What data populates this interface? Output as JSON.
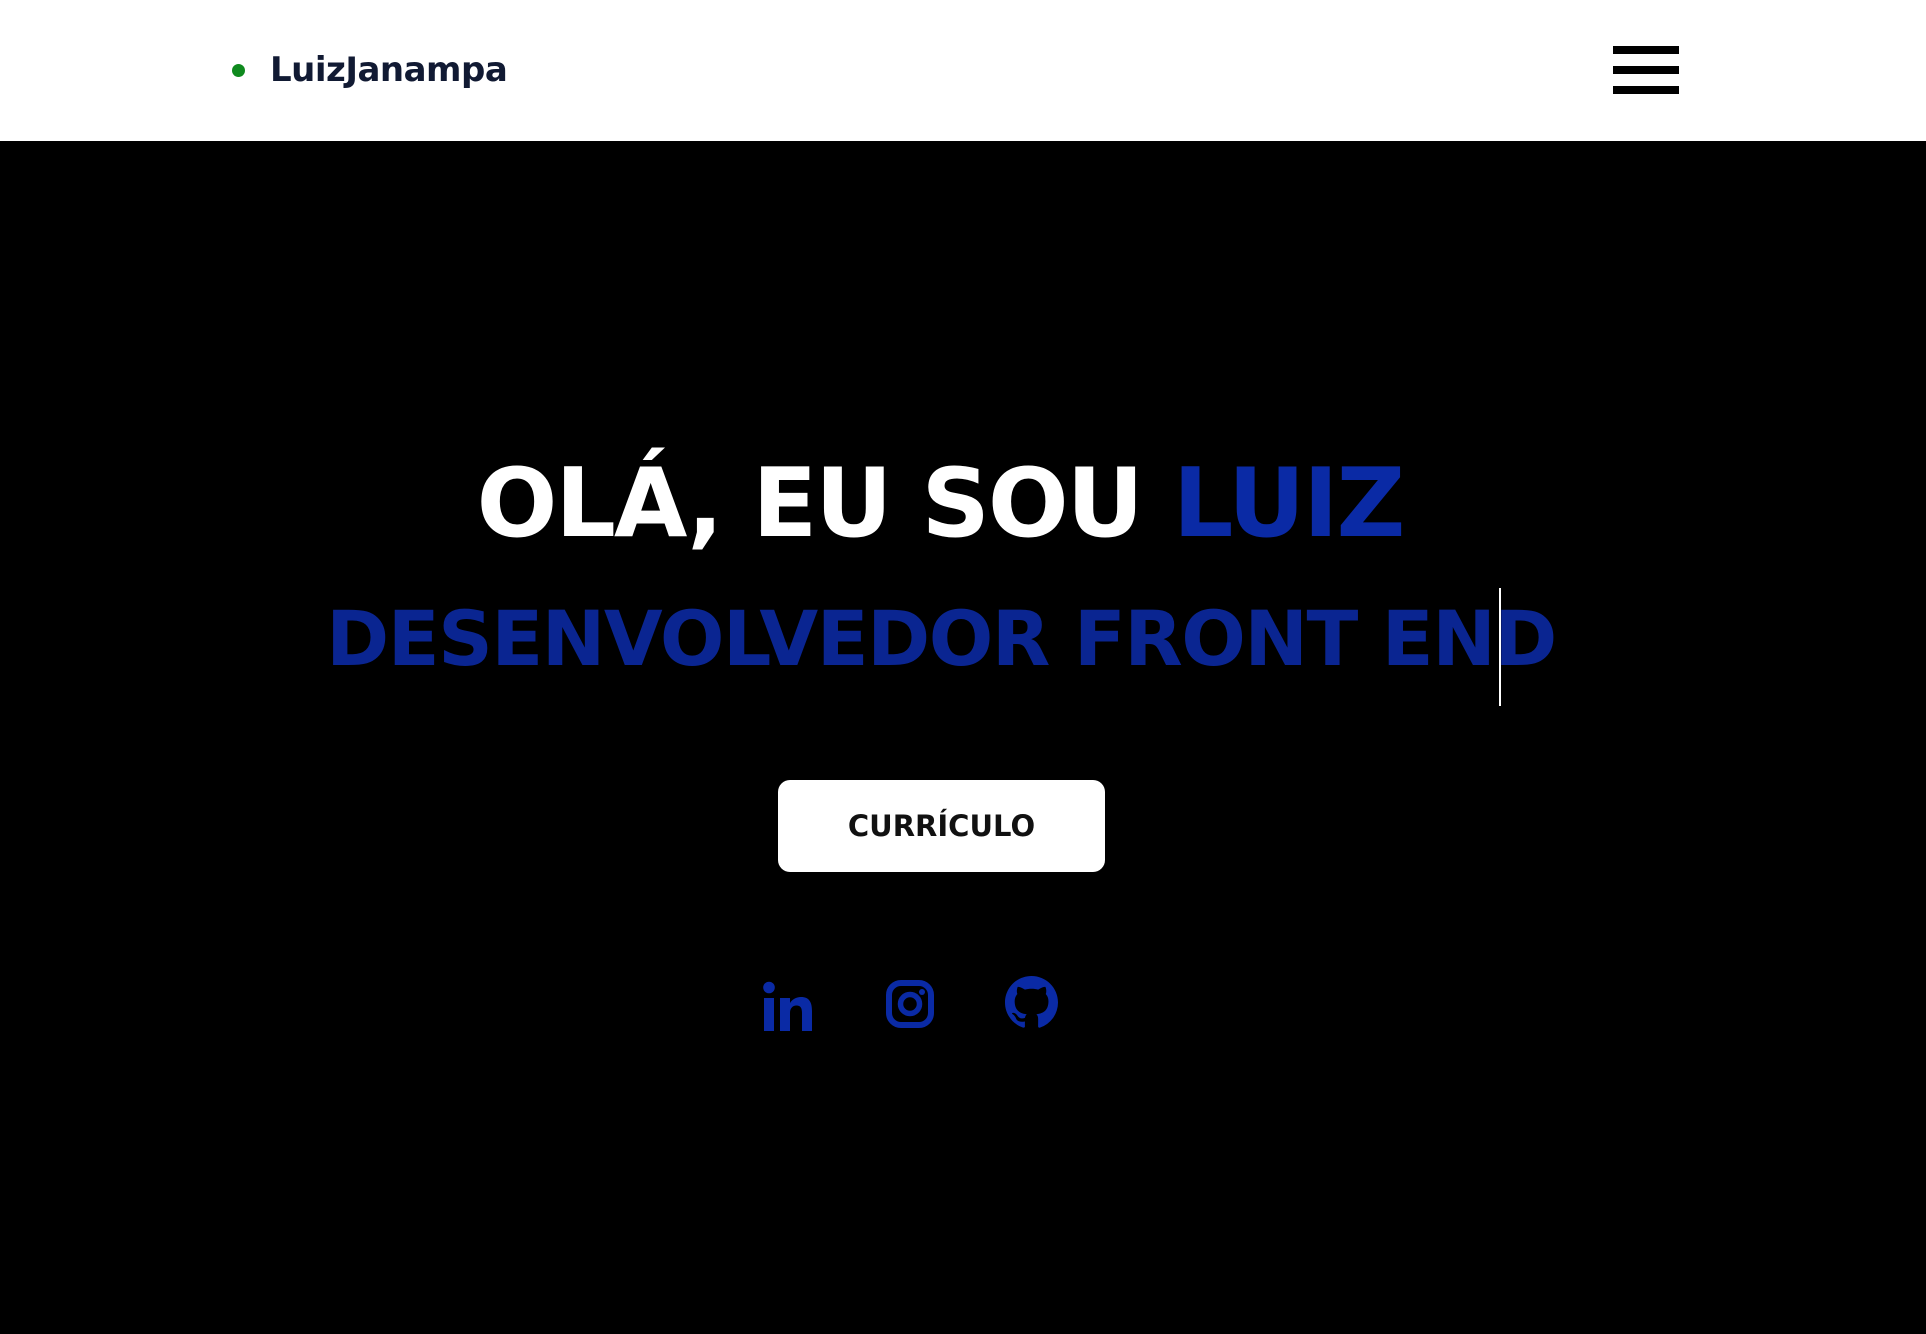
{
  "header": {
    "brand_name": "LuizJanampa",
    "status_color": "#0f8a1e",
    "menu_icon": "hamburger-menu-icon"
  },
  "hero": {
    "greeting": "OLÁ, EU SOU ",
    "name": "LUIZ",
    "subtitle": "DESENVOLVEDOR FRONT END",
    "cv_button_label": "CURRÍCULO",
    "accent_color": "#0a2aa5"
  },
  "social": [
    {
      "icon": "linkedin-icon",
      "network": "LinkedIn"
    },
    {
      "icon": "instagram-icon",
      "network": "Instagram"
    },
    {
      "icon": "github-icon",
      "network": "GitHub"
    }
  ],
  "colors": {
    "header_background": "#ffffff",
    "hero_background": "#000000",
    "brand_text": "#111a33",
    "title_text": "#ffffff"
  }
}
